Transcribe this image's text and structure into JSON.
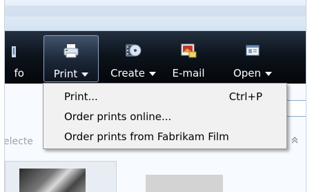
{
  "toolbar": {
    "items": [
      {
        "label": "fo",
        "icon": "info-icon"
      },
      {
        "label": "Print",
        "icon": "printer-icon"
      },
      {
        "label": "Create",
        "icon": "film-disc-icon"
      },
      {
        "label": "E-mail",
        "icon": "email-photo-icon"
      },
      {
        "label": "Open",
        "icon": "open-window-icon"
      }
    ]
  },
  "content": {
    "selected_text": "electe"
  },
  "print_menu": {
    "items": [
      {
        "label": "Print...",
        "shortcut": "Ctrl+P"
      },
      {
        "label": "Order prints online..."
      },
      {
        "label": "Order prints from Fabrikam Film"
      }
    ]
  },
  "colors": {
    "toolbar_bg": "#0d141d",
    "menu_bg": "#f1f1f1",
    "window_bg": "#f4f8fc"
  }
}
